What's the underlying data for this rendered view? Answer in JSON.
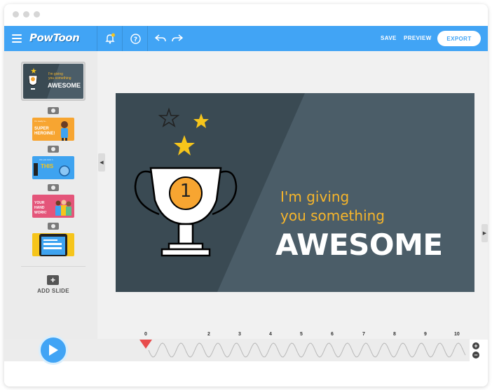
{
  "app": {
    "logo": "PowToon"
  },
  "toolbar": {
    "save_label": "SAVE",
    "preview_label": "PREVIEW",
    "export_label": "EXPORT",
    "icons": [
      "menu-icon",
      "bell-icon",
      "help-icon",
      "undo-icon",
      "redo-icon"
    ]
  },
  "sidebar": {
    "slides": [
      {
        "line1": "I'm giving",
        "line2": "you something",
        "title": "AWESOME",
        "color": "#3a4a53"
      },
      {
        "line1": "I'm ready to...",
        "title": "SUPER HEROINE!",
        "color": "#f7a531"
      },
      {
        "line1": "Are you sure I...",
        "title": "THIS",
        "color": "#3ea3f0"
      },
      {
        "line1": "",
        "title": "YOUR HAND WORK!",
        "color": "#e4557a"
      },
      {
        "line1": "",
        "title": "",
        "color": "#f6c51b"
      }
    ],
    "add_slide_label": "ADD SLIDE"
  },
  "slide": {
    "line1": "I'm giving",
    "line2": "you something",
    "title": "AWESOME",
    "trophy_number": "1",
    "colors": {
      "background": "#3a4a53",
      "accent": "#f6b52b",
      "title": "#ffffff"
    }
  },
  "timeline": {
    "ticks": [
      "0",
      "2",
      "3",
      "4",
      "5",
      "6",
      "7",
      "8",
      "9",
      "10"
    ],
    "playhead": "0",
    "zoom_in": "+",
    "zoom_out": "−"
  }
}
